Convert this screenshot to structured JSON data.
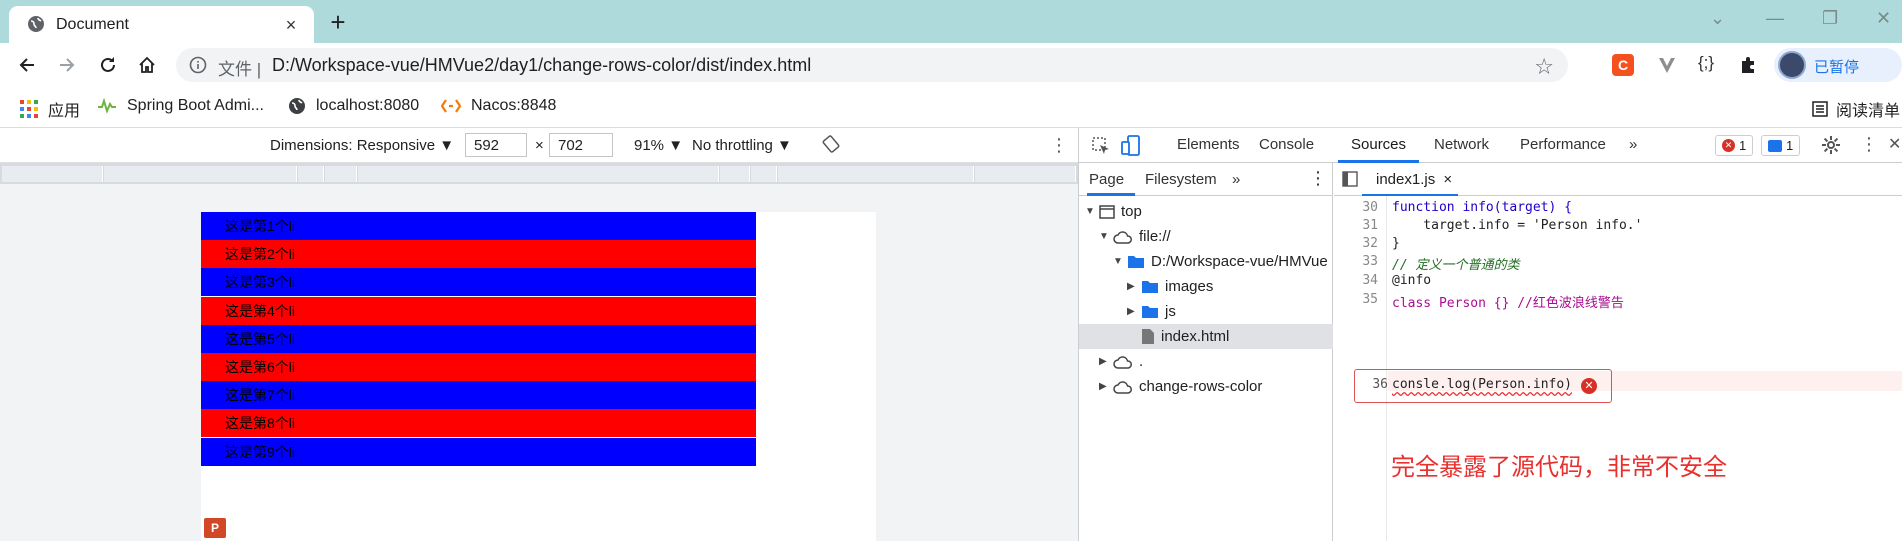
{
  "tab": {
    "title": "Document",
    "close": "×"
  },
  "new_tab": "+",
  "window": {
    "minimize": "—",
    "maximize": "❐",
    "close": "✕",
    "chevron": "⌄"
  },
  "omnibox": {
    "protocol": "文件 |",
    "url": "D:/Workspace-vue/HMVue2/day1/change-rows-color/dist/index.html"
  },
  "profile": {
    "label": "已暂停"
  },
  "bookmarks": [
    {
      "label": "应用",
      "icon": "apps-grid-icon"
    },
    {
      "label": "Spring Boot Admi...",
      "icon": "spring-boot-icon"
    },
    {
      "label": "localhost:8080",
      "icon": "globe-icon"
    },
    {
      "label": "Nacos:8848",
      "icon": "nacos-icon"
    }
  ],
  "reading_list": "阅读清单",
  "emulation": {
    "dimensions": "Dimensions: Responsive ▼",
    "width": "592",
    "height": "702",
    "x": "×",
    "zoom": "91% ▼",
    "throttling": "No throttling ▼"
  },
  "rows": [
    {
      "text": "这是第1个li",
      "color": "#0000ff"
    },
    {
      "text": "这是第2个li",
      "color": "#ff0000"
    },
    {
      "text": "这是第3个li",
      "color": "#0000ff"
    },
    {
      "text": "这是第4个li",
      "color": "#ff0000"
    },
    {
      "text": "这是第5个li",
      "color": "#0000ff"
    },
    {
      "text": "这是第6个li",
      "color": "#ff0000"
    },
    {
      "text": "这是第7个li",
      "color": "#0000ff"
    },
    {
      "text": "这是第8个li",
      "color": "#ff0000"
    },
    {
      "text": "这是第9个li",
      "color": "#0000ff"
    }
  ],
  "devtools": {
    "tabs": [
      "Elements",
      "Console",
      "Sources",
      "Network",
      "Performance"
    ],
    "active_tab": "Sources",
    "more": "»",
    "error_count": "1",
    "message_count": "1"
  },
  "navigator": {
    "tabs": [
      "Page",
      "Filesystem"
    ],
    "more": "»",
    "tree": [
      {
        "label": "top",
        "indent": 0,
        "toggle": "▼",
        "icon": "frame"
      },
      {
        "label": "file://",
        "indent": 1,
        "toggle": "▼",
        "icon": "cloud"
      },
      {
        "label": "D:/Workspace-vue/HMVue",
        "indent": 2,
        "toggle": "▼",
        "icon": "folder"
      },
      {
        "label": "images",
        "indent": 3,
        "toggle": "▶",
        "icon": "folder"
      },
      {
        "label": "js",
        "indent": 3,
        "toggle": "▶",
        "icon": "folder"
      },
      {
        "label": "index.html",
        "indent": 3,
        "toggle": "",
        "icon": "file",
        "selected": true
      },
      {
        "label": ".",
        "indent": 1,
        "toggle": "▶",
        "icon": "cloud"
      },
      {
        "label": "change-rows-color",
        "indent": 1,
        "toggle": "▶",
        "icon": "cloud"
      }
    ]
  },
  "editor": {
    "file_tab": "index1.js",
    "file_close": "×",
    "lines": [
      {
        "num": "30",
        "code": "function info(target) {"
      },
      {
        "num": "31",
        "code": "    target.info = 'Person info.'"
      },
      {
        "num": "32",
        "code": "}"
      },
      {
        "num": "33",
        "code": "// 定义一个普通的类"
      },
      {
        "num": "34",
        "code": "@info"
      },
      {
        "num": "35",
        "code": "class Person {} //红色波浪线警告"
      }
    ],
    "error_line": {
      "num": "36",
      "code": "consle.log(Person.info)"
    },
    "annotation": "完全暴露了源代码，非常不安全"
  }
}
